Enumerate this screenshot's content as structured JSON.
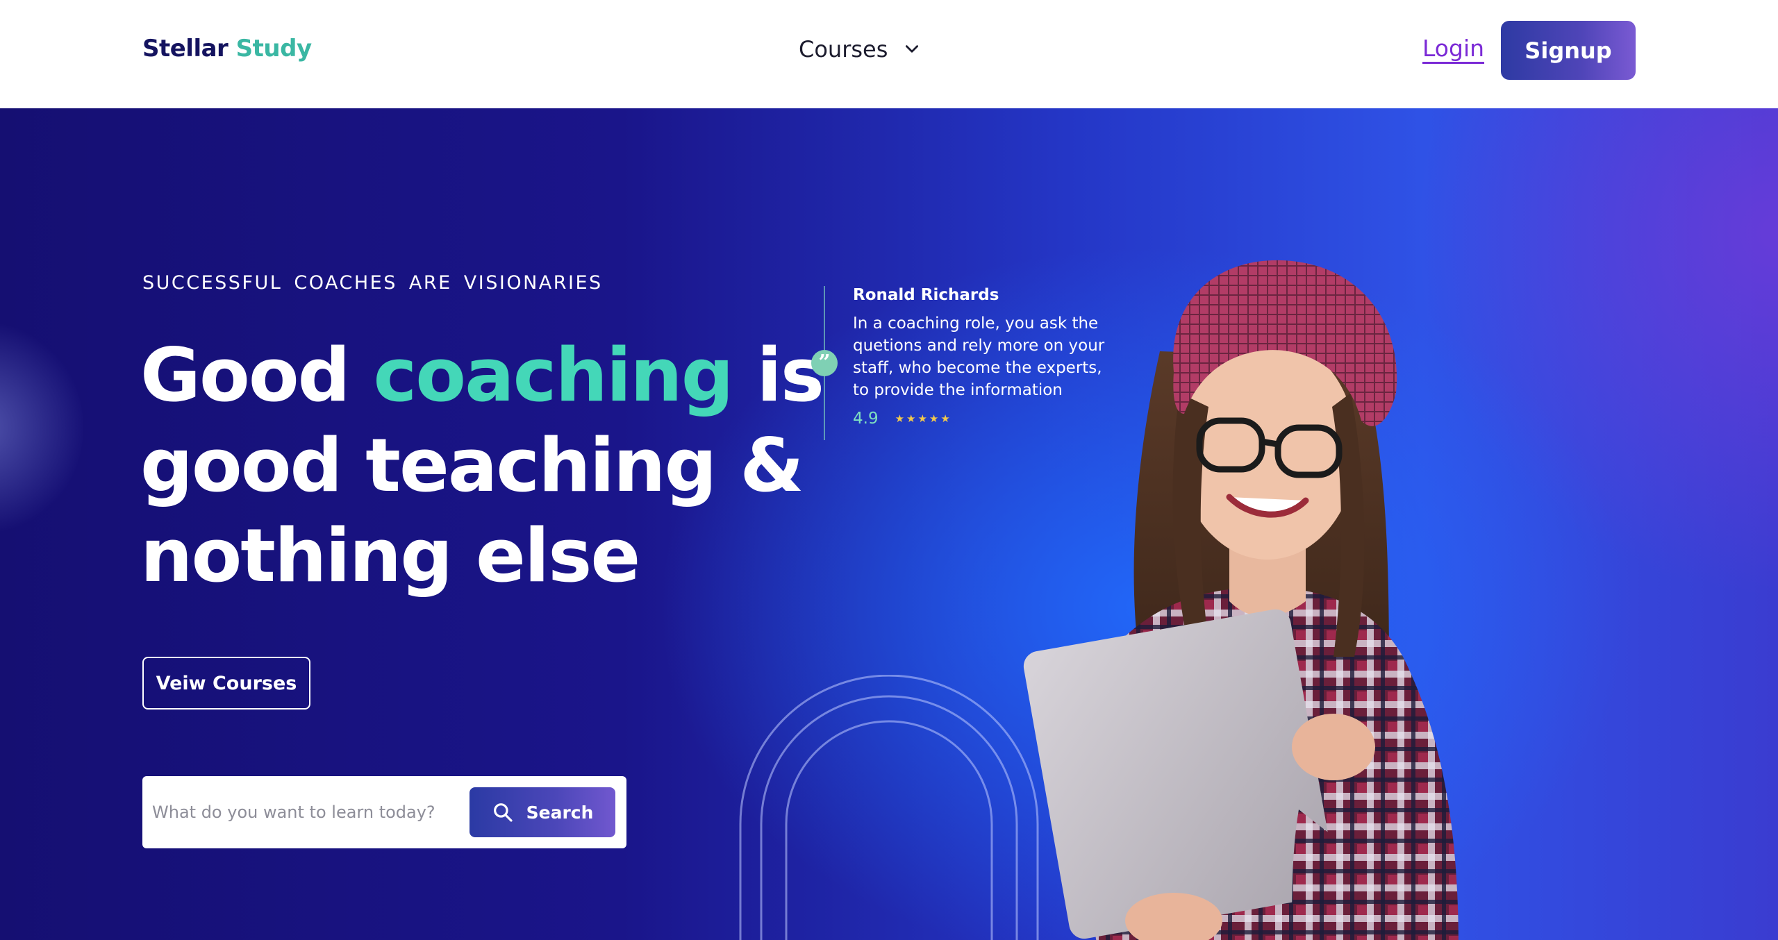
{
  "header": {
    "logo_part_a": "Stellar",
    "logo_part_b": "Study",
    "nav_courses_label": "Courses",
    "login_label": "Login",
    "signup_label": "Signup"
  },
  "hero": {
    "eyebrow": "SUCCESSFUL  COACHES  ARE  VISIONARIES",
    "headline_part1": "Good ",
    "headline_accent": "coaching",
    "headline_part2": " is good teaching & nothing else",
    "view_courses_label": "Veiw Courses",
    "search": {
      "placeholder": "What do you want to learn today?",
      "button_label": "Search"
    }
  },
  "testimonial": {
    "name": "Ronald Richards",
    "quote": "In a coaching role, you ask the quetions and rely more on your staff, who become the experts, to provide the information",
    "rating": "4.9",
    "stars": "★★★★★",
    "quote_mark": "”"
  },
  "icons": {
    "chevron": "chevron-down-icon",
    "search": "search-icon",
    "quote": "quote-icon",
    "star": "star-icon"
  },
  "colors": {
    "brand_dark": "#14135f",
    "brand_teal": "#3ab7a3",
    "accent_green": "#44d7b8",
    "link_purple": "#7b2ad6",
    "hero_blue": "#2436c6"
  }
}
